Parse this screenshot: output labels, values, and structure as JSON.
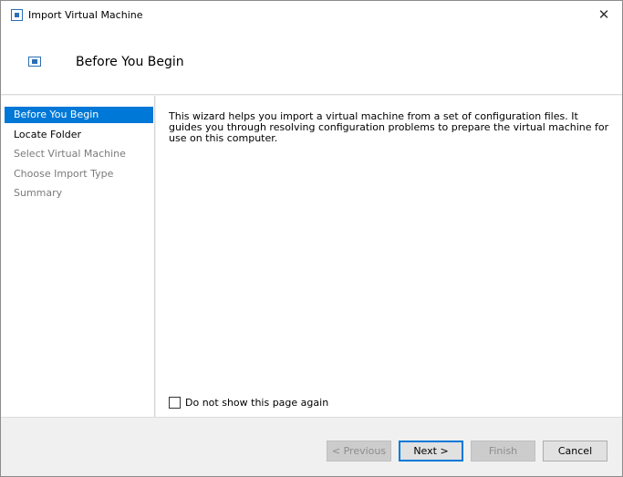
{
  "window": {
    "title": "Import Virtual Machine",
    "close_glyph": "✕",
    "title_icon": "hyper-v-import-icon"
  },
  "header": {
    "title": "Before You Begin",
    "icon": "hyper-v-import-icon"
  },
  "sidebar": {
    "items": [
      {
        "label": "Before You Begin",
        "state": "active"
      },
      {
        "label": "Locate Folder",
        "state": "enabled"
      },
      {
        "label": "Select Virtual Machine",
        "state": "disabled"
      },
      {
        "label": "Choose Import Type",
        "state": "disabled"
      },
      {
        "label": "Summary",
        "state": "disabled"
      }
    ]
  },
  "main": {
    "description": "This wizard helps you import a virtual machine from a set of configuration files. It guides you through resolving configuration problems to prepare the virtual machine for use on this computer.",
    "checkbox": {
      "label": "Do not show this page again",
      "checked": false
    }
  },
  "buttons": {
    "previous": "< Previous",
    "next": "Next >",
    "finish": "Finish",
    "cancel": "Cancel"
  },
  "colors": {
    "accent": "#0078d7",
    "disabled_text": "#7a7a7a"
  }
}
